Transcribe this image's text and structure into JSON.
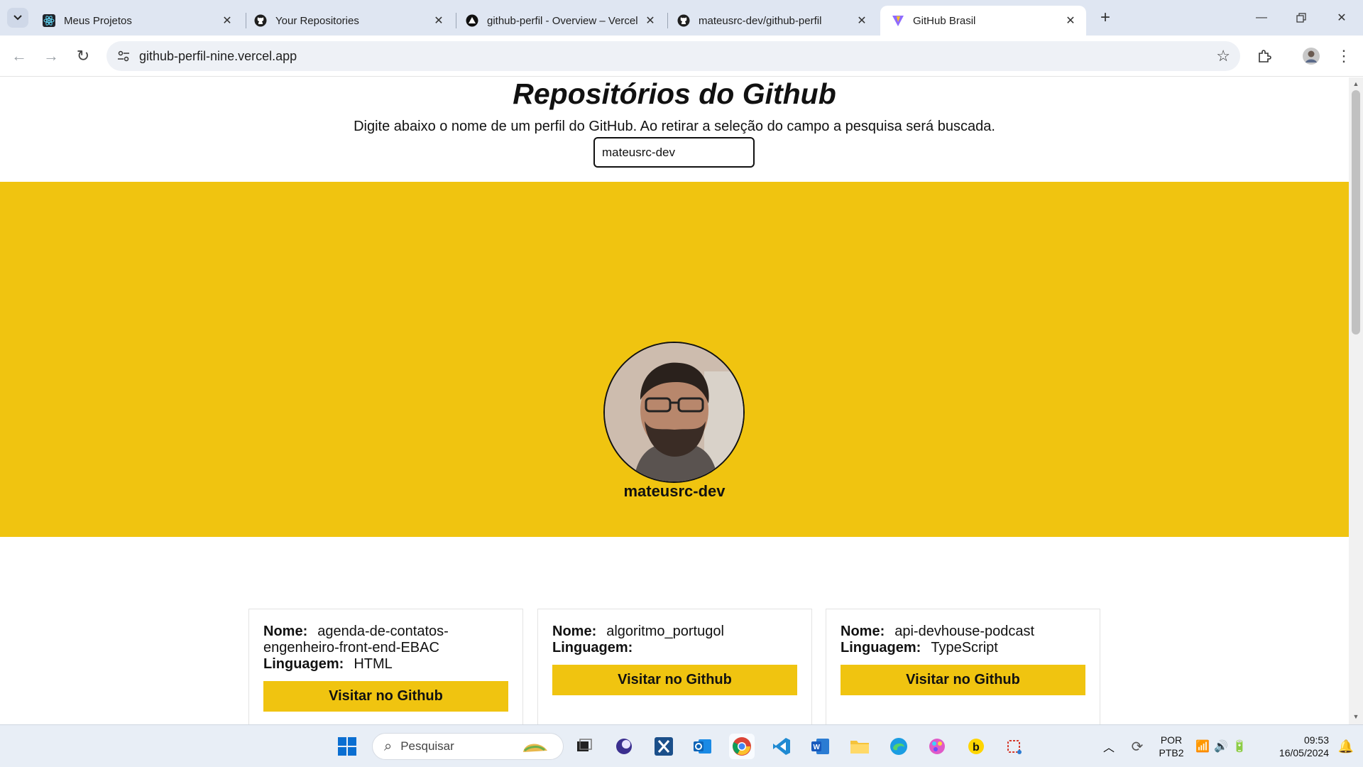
{
  "browser": {
    "tabs": [
      {
        "title": "Meus Projetos",
        "icon": "react-icon"
      },
      {
        "title": "Your Repositories",
        "icon": "github-icon"
      },
      {
        "title": "github-perfil - Overview – Vercel",
        "icon": "vercel-icon"
      },
      {
        "title": "mateusrc-dev/github-perfil",
        "icon": "github-icon"
      },
      {
        "title": "GitHub Brasil",
        "icon": "vite-icon",
        "active": true
      }
    ],
    "url": "github-perfil-nine.vercel.app"
  },
  "page": {
    "title": "Repositórios do Github",
    "subtitle": "Digite abaixo o nome de um perfil do GitHub. Ao retirar a seleção do campo a pesquisa será buscada.",
    "search_value": "mateusrc-dev",
    "profile": {
      "username": "mateusrc-dev"
    },
    "repo_labels": {
      "name": "Nome:",
      "language": "Linguagem:",
      "button": "Visitar no Github"
    },
    "repos": [
      {
        "name": "agenda-de-contatos-engenheiro-front-end-EBAC",
        "language": "HTML"
      },
      {
        "name": "algoritmo_portugol",
        "language": ""
      },
      {
        "name": "api-devhouse-podcast",
        "language": "TypeScript"
      }
    ],
    "accent_color": "#f0c410"
  },
  "taskbar": {
    "search_placeholder": "Pesquisar",
    "lang_line1": "POR",
    "lang_line2": "PTB2",
    "time": "09:53",
    "date": "16/05/2024"
  }
}
